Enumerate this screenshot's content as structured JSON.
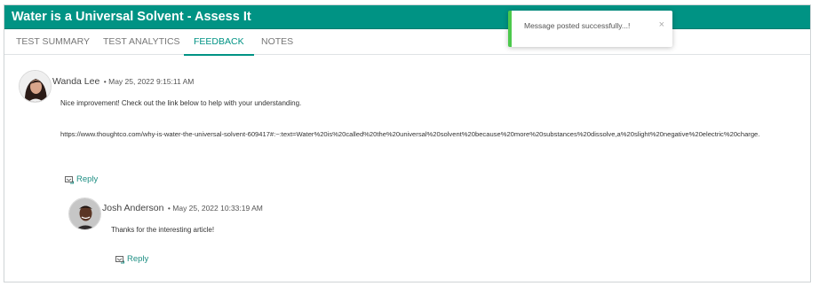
{
  "header": {
    "title": "Water is a Universal Solvent - Assess It"
  },
  "tabs": [
    {
      "label": "TEST SUMMARY"
    },
    {
      "label": "TEST ANALYTICS"
    },
    {
      "label": "FEEDBACK"
    },
    {
      "label": "NOTES"
    }
  ],
  "active_tab": "FEEDBACK",
  "comments": [
    {
      "author": "Wanda Lee",
      "date": "• May 25, 2022 9:15:11 AM",
      "text": "Nice improvement! Check out the link below to help with your understanding.",
      "link": "https://www.thoughtco.com/why-is-water-the-universal-solvent-609417#:~:text=Water%20is%20called%20the%20universal%20solvent%20because%20more%20substances%20dissolve,a%20slight%20negative%20electric%20charge.",
      "reply_label": "Reply",
      "reply": {
        "author": "Josh Anderson",
        "date": "• May 25, 2022 10:33:19 AM",
        "text": "Thanks for the interesting article!",
        "reply_label": "Reply"
      }
    }
  ],
  "toast": {
    "message": "Message posted successfully...!",
    "close_symbol": "×"
  },
  "colors": {
    "brand": "#009384",
    "toast_accent": "#4cc94c",
    "link": "#1f8f84"
  },
  "icons": {
    "reply": "reply-icon",
    "close": "close-icon"
  }
}
